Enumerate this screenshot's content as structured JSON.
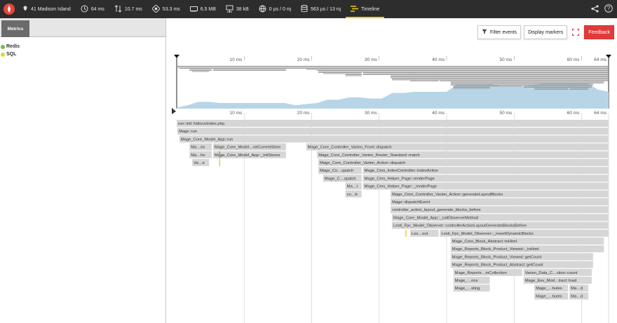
{
  "topbar": {
    "items": [
      {
        "icon": "location-icon",
        "text": "41 Madison Island"
      },
      {
        "icon": "clock-icon",
        "text": "64 ms"
      },
      {
        "icon": "io-wait-icon",
        "text": "10.7 ms"
      },
      {
        "icon": "cpu-icon",
        "text": "53.3 ms"
      },
      {
        "icon": "memory-icon",
        "text": "6.5 MB"
      },
      {
        "icon": "network-icon",
        "text": "38 kB"
      },
      {
        "icon": "sql-queries-icon",
        "text": "0 µs / 0 rq"
      },
      {
        "icon": "storage-icon",
        "text": "563 µs / 13 rq"
      },
      {
        "icon": "timeline-icon",
        "text": "Timeline"
      }
    ]
  },
  "sidebar": {
    "tab": "Metrics",
    "legend": [
      {
        "label": "Redis",
        "color": "#7ab648"
      },
      {
        "label": "SQL",
        "color": "#d7d93c"
      }
    ]
  },
  "toolbar": {
    "filter": "Filter events",
    "markers": "Display markers",
    "feedback": "Feedback"
  },
  "timeline": {
    "ticks": [
      {
        "ms": 10,
        "label": "10 ms"
      },
      {
        "ms": 20,
        "label": "20 ms"
      },
      {
        "ms": 30,
        "label": "30 ms"
      },
      {
        "ms": 40,
        "label": "40 ms"
      },
      {
        "ms": 50,
        "label": "50 ms"
      },
      {
        "ms": 60,
        "label": "60 ms"
      },
      {
        "ms": 64,
        "label": "64 ms"
      }
    ],
    "spans": [
      {
        "row": 0,
        "start": 0,
        "end": 64,
        "label": "run::init::htdocs/index.php"
      },
      {
        "row": 1,
        "start": 0.1,
        "end": 64,
        "label": "Mage::run"
      },
      {
        "row": 2,
        "start": 0.4,
        "end": 64,
        "label": "Mage_Core_Model_App::run"
      },
      {
        "row": 3,
        "start": 1.9,
        "end": 5.2,
        "label": "Ma…es"
      },
      {
        "row": 3,
        "start": 5.4,
        "end": 16.2,
        "label": "Mage_Core_Model…nitCurrentStore"
      },
      {
        "row": 3,
        "start": 19.2,
        "end": 64,
        "label": "Mage_Core_Controller_Varien_Front::dispatch"
      },
      {
        "row": 4,
        "start": 1.9,
        "end": 5.2,
        "label": "Ma…he"
      },
      {
        "row": 4,
        "start": 5.4,
        "end": 16.2,
        "label": "Mage_Core_Model_App::_initStores"
      },
      {
        "row": 4,
        "start": 20.8,
        "end": 64,
        "label": "Mage_Core_Controller_Varien_Router_Standard::match"
      },
      {
        "row": 5,
        "start": 2.3,
        "end": 4.8,
        "label": "Va…e"
      },
      {
        "row": 5,
        "start": 21.0,
        "end": 64,
        "label": "Mage_Core_Controller_Varien_Action::dispatch"
      },
      {
        "row": 6,
        "start": 21.0,
        "end": 27.4,
        "label": "Mage_Co…spatch"
      },
      {
        "row": 6,
        "start": 27.6,
        "end": 64,
        "label": "Mage_Cms_IndexController::indexAction"
      },
      {
        "row": 7,
        "start": 21.7,
        "end": 27.4,
        "label": "Mage_C…spatch"
      },
      {
        "row": 7,
        "start": 27.6,
        "end": 64,
        "label": "Mage_Cms_Helper_Page::renderPage"
      },
      {
        "row": 8,
        "start": 25.0,
        "end": 27.4,
        "label": "Ma…t"
      },
      {
        "row": 8,
        "start": 27.6,
        "end": 64,
        "label": "Mage_Cms_Helper_Page::_renderPage"
      },
      {
        "row": 9,
        "start": 25.0,
        "end": 27.4,
        "label": "co…b"
      },
      {
        "row": 9,
        "start": 31.7,
        "end": 64,
        "label": "Mage_Core_Controller_Varien_Action::generateLayoutBlocks"
      },
      {
        "row": 10,
        "start": 31.7,
        "end": 64,
        "label": "Mage::dispatchEvent"
      },
      {
        "row": 11,
        "start": 31.7,
        "end": 64,
        "label": "controller_action_layout_generate_blocks_before"
      },
      {
        "row": 12,
        "start": 31.9,
        "end": 64,
        "label": "Mage_Core_Model_App::_callObserverMethod"
      },
      {
        "row": 13,
        "start": 31.9,
        "end": 64,
        "label": "Lesti_Fpc_Model_Observer::controllerActionLayoutGenerateBlocksBefore"
      },
      {
        "row": 14,
        "start": 34.6,
        "end": 38.8,
        "label": "Les…out"
      },
      {
        "row": 14,
        "start": 39.0,
        "end": 64,
        "label": "Lesti_Fpc_Model_Observer::_insertDynamicBlocks"
      },
      {
        "row": 15,
        "start": 40.6,
        "end": 63.3,
        "label": "Mage_Core_Block_Abstract::toHtml"
      },
      {
        "row": 16,
        "start": 40.6,
        "end": 63.3,
        "label": "Mage_Reports_Block_Product_Viewed::_toHtml"
      },
      {
        "row": 17,
        "start": 40.6,
        "end": 61.7,
        "label": "Mage_Reports_Block_Product_Viewed::getCount"
      },
      {
        "row": 18,
        "start": 40.6,
        "end": 61.7,
        "label": "Mage_Reports_Block_Product_Abstract::getCount"
      },
      {
        "row": 19,
        "start": 41.0,
        "end": 51.2,
        "label": "Mage_Reports…mCollection"
      },
      {
        "row": 19,
        "start": 51.4,
        "end": 61.5,
        "label": "Varien_Data_C…ction::count"
      },
      {
        "row": 20,
        "start": 41.0,
        "end": 46.4,
        "label": "Mage_…ons"
      },
      {
        "row": 20,
        "start": 51.4,
        "end": 61.5,
        "label": "Mage_Eav_Mod…tract::load"
      },
      {
        "row": 21,
        "start": 41.0,
        "end": 46.4,
        "label": "Mage_…sting"
      },
      {
        "row": 21,
        "start": 53.0,
        "end": 58.0,
        "label": "Mage_…butes"
      },
      {
        "row": 21,
        "start": 58.2,
        "end": 61.0,
        "label": "Ma…d"
      },
      {
        "row": 22,
        "start": 53.0,
        "end": 58.0,
        "label": "Mage_…butes"
      },
      {
        "row": 22,
        "start": 58.2,
        "end": 61.0,
        "label": "Ma…d"
      }
    ],
    "events": [
      {
        "row": 4,
        "ms": 6.3,
        "type": "Redis"
      },
      {
        "row": 5,
        "ms": 6.3,
        "type": "SQL"
      },
      {
        "row": 14,
        "ms": 33.9,
        "type": "SQL"
      }
    ]
  },
  "colors": {
    "topbar_bg": "#2d2d2d",
    "accent": "#f2c811",
    "span_fill": "#d6d6d6",
    "area_fill": "#b7d5e6",
    "feedback_bg": "#e03b3b"
  }
}
